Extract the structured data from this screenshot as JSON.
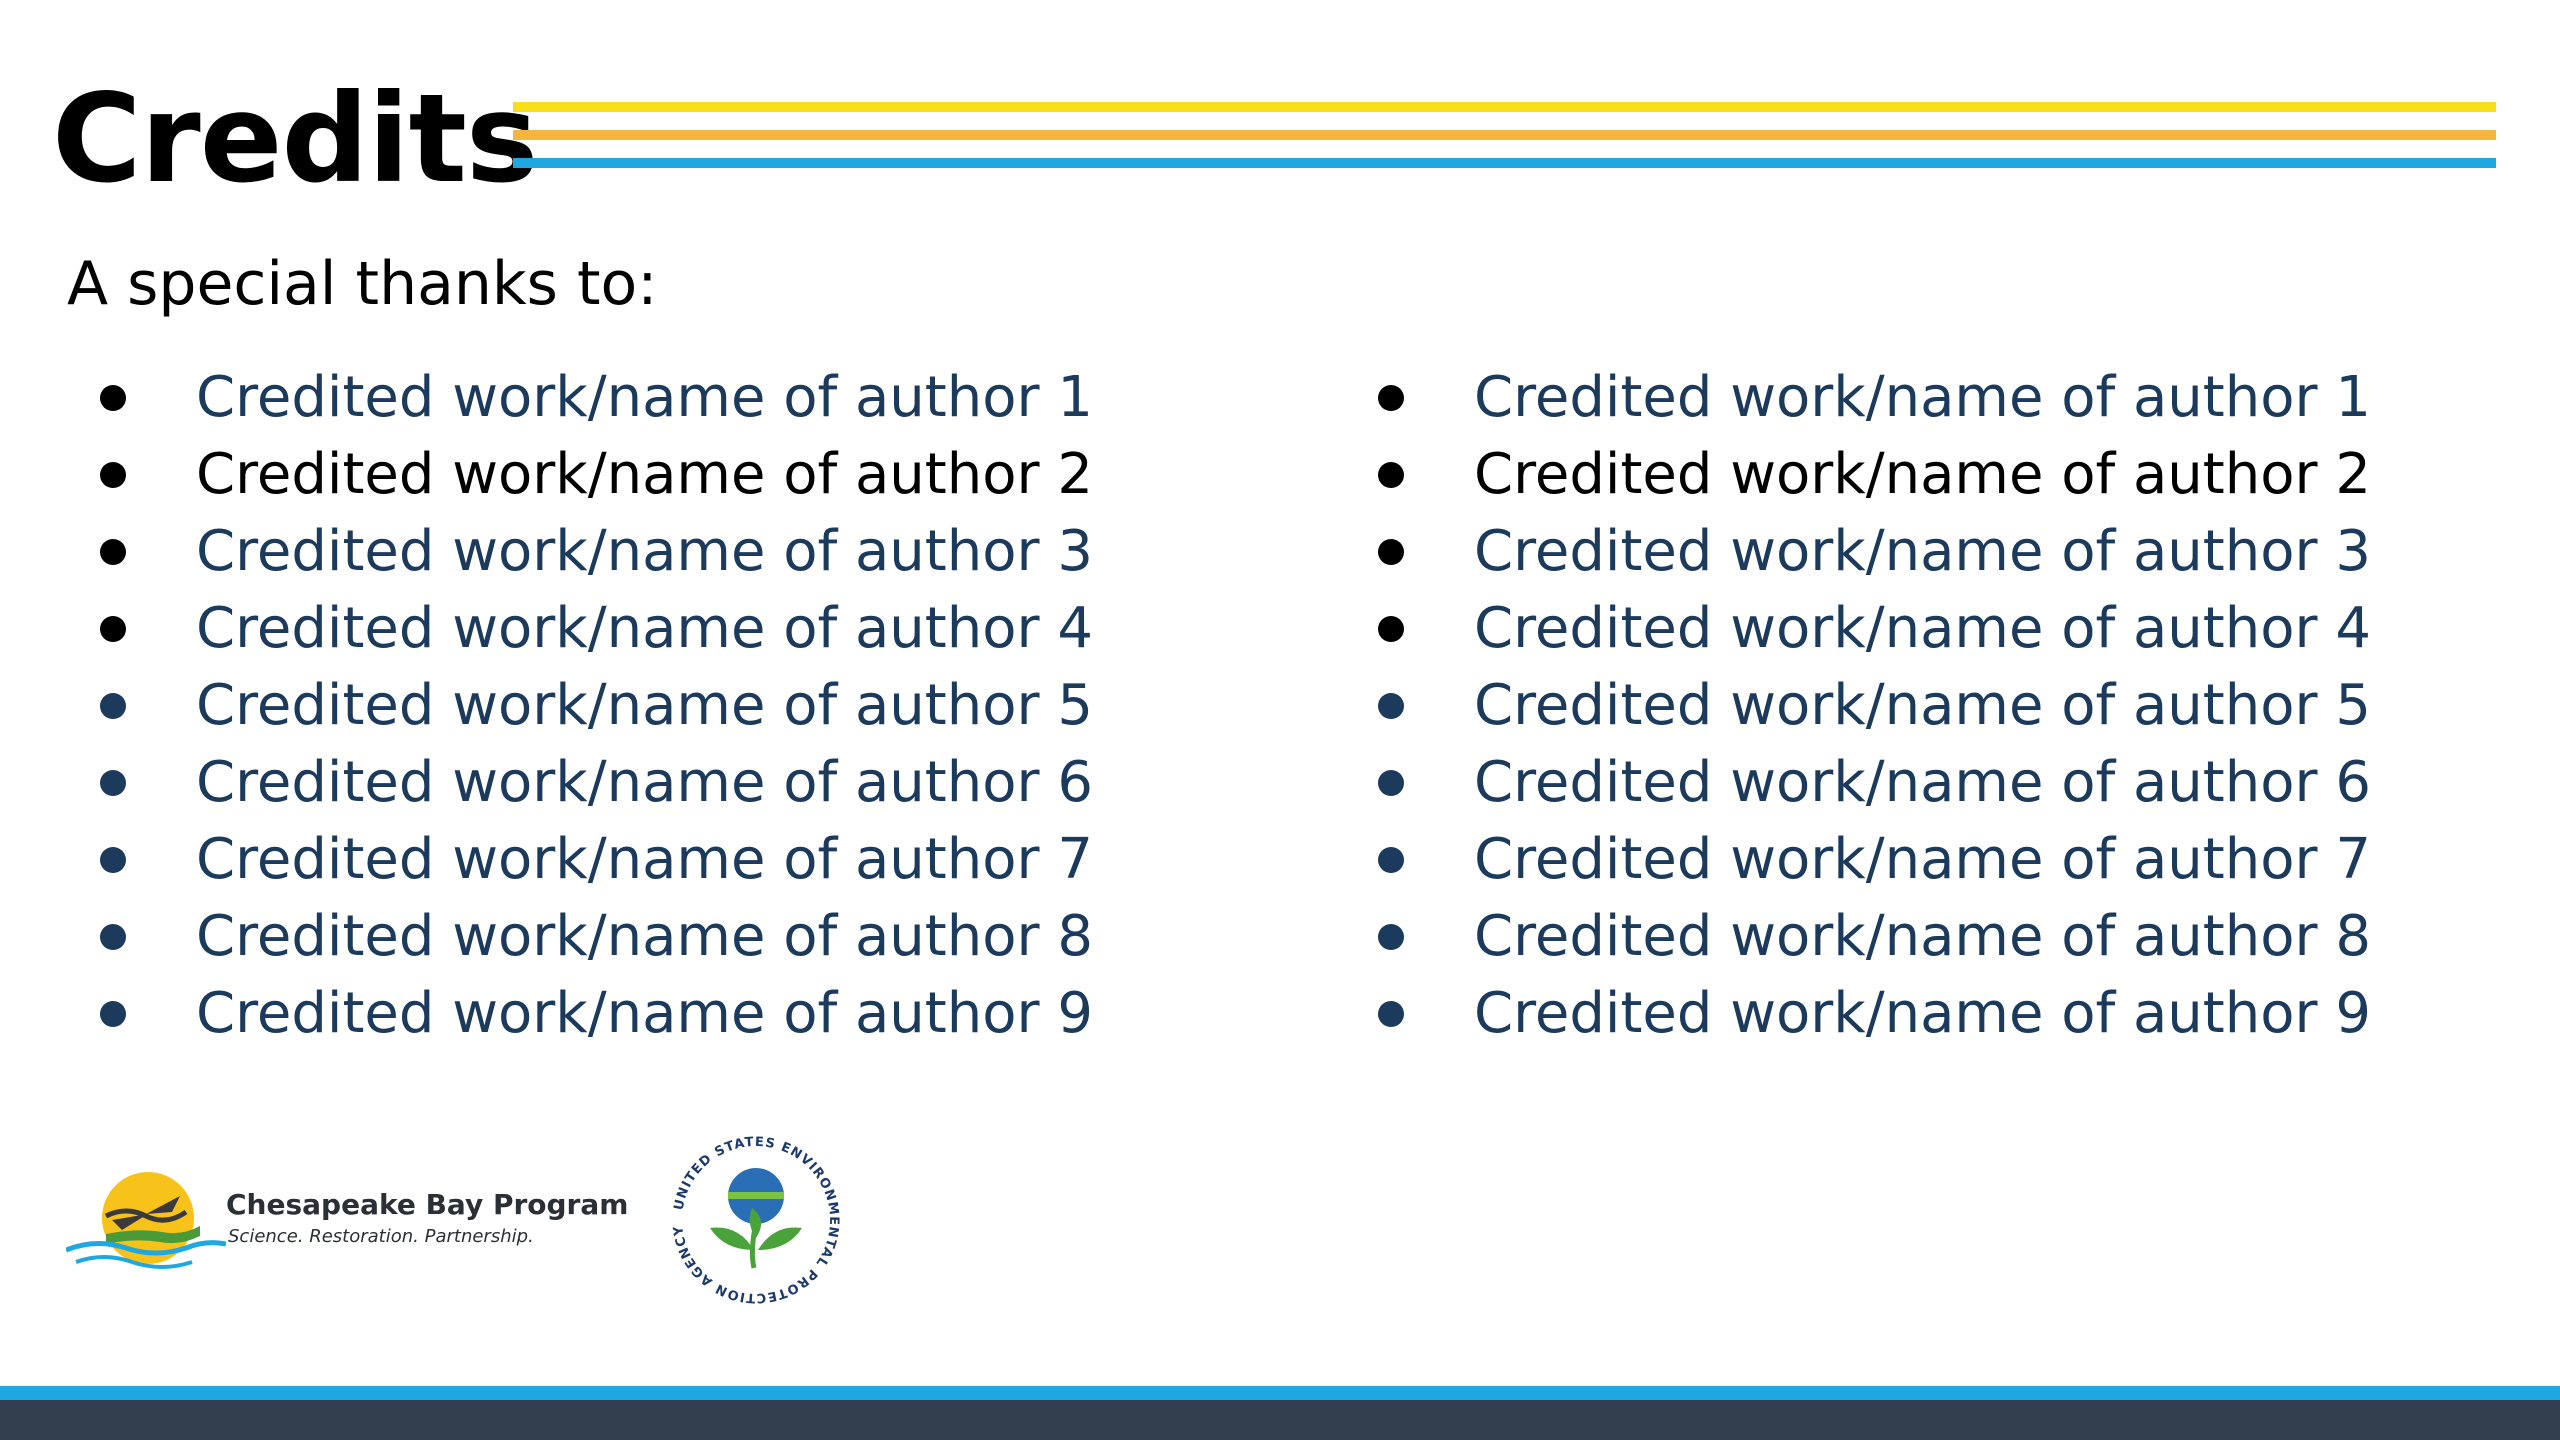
{
  "slide": {
    "title": "Credits",
    "subtitle": "A special thanks to:"
  },
  "colors": {
    "stripe_yellow": "#f7e017",
    "stripe_orange": "#f4b63f",
    "stripe_blue": "#1ea7e1",
    "link_blue": "#1b3a5c",
    "text_black": "#000000",
    "footer_light_blue": "#1ea7e1",
    "footer_dark": "#333f4f"
  },
  "credits": {
    "left": [
      {
        "text": "Credited work/name of author 1",
        "color": "#1b3a5c",
        "bullet_color": "#000000"
      },
      {
        "text": "Credited work/name of author 2",
        "color": "#000000",
        "bullet_color": "#000000"
      },
      {
        "text": "Credited work/name of author 3",
        "color": "#1b3a5c",
        "bullet_color": "#000000"
      },
      {
        "text": "Credited work/name of author 4",
        "color": "#1b3a5c",
        "bullet_color": "#000000"
      },
      {
        "text": "Credited work/name of author 5",
        "color": "#1b3a5c",
        "bullet_color": "#1b3a5c"
      },
      {
        "text": "Credited work/name of author 6",
        "color": "#1b3a5c",
        "bullet_color": "#1b3a5c"
      },
      {
        "text": "Credited work/name of author 7",
        "color": "#1b3a5c",
        "bullet_color": "#1b3a5c"
      },
      {
        "text": "Credited work/name of author 8",
        "color": "#1b3a5c",
        "bullet_color": "#1b3a5c"
      },
      {
        "text": "Credited work/name of author 9",
        "color": "#1b3a5c",
        "bullet_color": "#1b3a5c"
      }
    ],
    "right": [
      {
        "text": "Credited work/name of author 1",
        "color": "#1b3a5c",
        "bullet_color": "#000000"
      },
      {
        "text": "Credited work/name of author 2",
        "color": "#000000",
        "bullet_color": "#000000"
      },
      {
        "text": "Credited work/name of author 3",
        "color": "#1b3a5c",
        "bullet_color": "#000000"
      },
      {
        "text": "Credited work/name of author 4",
        "color": "#1b3a5c",
        "bullet_color": "#000000"
      },
      {
        "text": "Credited work/name of author 5",
        "color": "#1b3a5c",
        "bullet_color": "#1b3a5c"
      },
      {
        "text": "Credited work/name of author 6",
        "color": "#1b3a5c",
        "bullet_color": "#1b3a5c"
      },
      {
        "text": "Credited work/name of author 7",
        "color": "#1b3a5c",
        "bullet_color": "#1b3a5c"
      },
      {
        "text": "Credited work/name of author 8",
        "color": "#1b3a5c",
        "bullet_color": "#1b3a5c"
      },
      {
        "text": "Credited work/name of author 9",
        "color": "#1b3a5c",
        "bullet_color": "#1b3a5c"
      }
    ]
  },
  "logos": {
    "cbp": {
      "name": "Chesapeake Bay Program",
      "tagline": "Science. Restoration. Partnership.",
      "icon": "chesapeake-bay-program-logo"
    },
    "epa": {
      "seal_text": "UNITED STATES ENVIRONMENTAL PROTECTION AGENCY",
      "icon": "epa-seal"
    }
  }
}
